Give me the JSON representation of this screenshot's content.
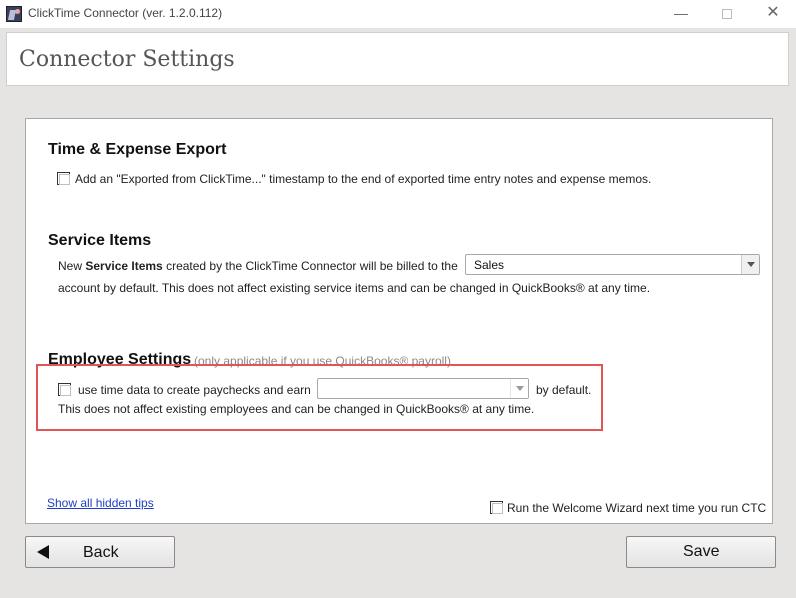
{
  "window": {
    "title": "ClickTime Connector (ver. 1.2.0.112)",
    "minimize_glyph": "—",
    "close_glyph": "✕"
  },
  "header": {
    "title": "Connector Settings"
  },
  "time_expense": {
    "title": "Time & Expense Export",
    "checkbox_label": "Add an \"Exported from ClickTime...\" timestamp to the end of exported time entry notes and expense memos.",
    "checked": false
  },
  "service_items": {
    "title": "Service Items",
    "text_prefix": "New ",
    "text_bold": "Service Items",
    "text_suffix": " created by the ClickTime Connector will be billed to the",
    "account_select_value": "Sales",
    "text_line2": "account by default. This does not affect existing service items and can be changed in QuickBooks® at any time."
  },
  "employee_settings": {
    "title": "Employee Settings",
    "hint": "(only applicable if you use QuickBooks® payroll)",
    "checkbox_label": "use time data to create paychecks and earn",
    "earn_select_value": "",
    "after_select_text": "by default.",
    "note": "This does not affect existing employees and can be changed in QuickBooks® at any time.",
    "checked": false
  },
  "footer": {
    "show_tips_link": "Show all hidden tips",
    "welcome_wizard_label": "Run the Welcome Wizard next time you run CTC",
    "welcome_wizard_checked": false
  },
  "buttons": {
    "back": "Back",
    "save": "Save"
  },
  "colors": {
    "highlight_border": "#e05555",
    "link": "#1f3fc4",
    "background": "#e6e4e3"
  }
}
